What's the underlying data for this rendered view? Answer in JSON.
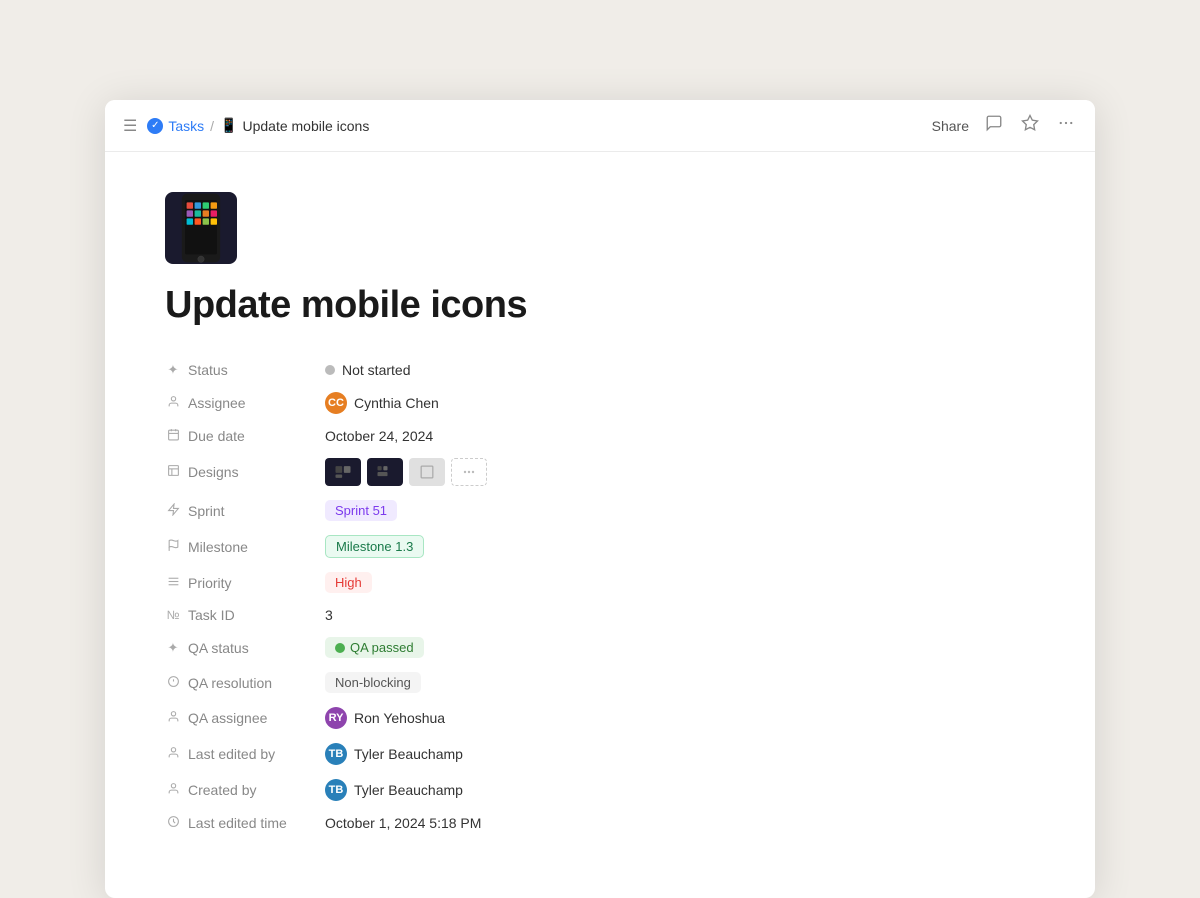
{
  "topbar": {
    "menu_label": "☰",
    "breadcrumb": {
      "tasks_label": "Tasks",
      "separator": "/",
      "current_label": "Update mobile icons"
    },
    "actions": {
      "share": "Share",
      "comment": "💬",
      "star": "☆",
      "more": "•••"
    }
  },
  "page": {
    "title": "Update mobile icons"
  },
  "properties": [
    {
      "icon": "✦",
      "label": "Status",
      "type": "status",
      "value": "Not started",
      "dot": "gray"
    },
    {
      "icon": "👤",
      "label": "Assignee",
      "type": "avatar",
      "value": "Cynthia Chen",
      "avatar_initials": "CC",
      "avatar_class": "avatar-cc"
    },
    {
      "icon": "📅",
      "label": "Due date",
      "type": "text",
      "value": "October 24, 2024"
    },
    {
      "icon": "🖼",
      "label": "Designs",
      "type": "designs",
      "value": ""
    },
    {
      "icon": "⚡",
      "label": "Sprint",
      "type": "tag",
      "value": "Sprint 51",
      "tag_class": "tag-purple"
    },
    {
      "icon": "🚩",
      "label": "Milestone",
      "type": "tag",
      "value": "Milestone 1.3",
      "tag_class": "tag-green-outline"
    },
    {
      "icon": "≡",
      "label": "Priority",
      "type": "tag",
      "value": "High",
      "tag_class": "tag-red"
    },
    {
      "icon": "№",
      "label": "Task ID",
      "type": "text",
      "value": "3"
    },
    {
      "icon": "✦",
      "label": "QA status",
      "type": "status-tag",
      "value": "QA passed",
      "dot": "green",
      "tag_class": "tag-green-solid"
    },
    {
      "icon": "⊕",
      "label": "QA resolution",
      "type": "tag",
      "value": "Non-blocking",
      "tag_class": "tag-gray"
    },
    {
      "icon": "👤",
      "label": "QA assignee",
      "type": "avatar",
      "value": "Ron Yehoshua",
      "avatar_initials": "RY",
      "avatar_class": "avatar-ry"
    },
    {
      "icon": "👤",
      "label": "Last edited by",
      "type": "avatar",
      "value": "Tyler Beauchamp",
      "avatar_initials": "TB",
      "avatar_class": "avatar-tb"
    },
    {
      "icon": "👤",
      "label": "Created by",
      "type": "avatar",
      "value": "Tyler Beauchamp",
      "avatar_initials": "TB",
      "avatar_class": "avatar-tb"
    },
    {
      "icon": "🕐",
      "label": "Last edited time",
      "type": "text",
      "value": "October 1, 2024 5:18 PM"
    }
  ]
}
